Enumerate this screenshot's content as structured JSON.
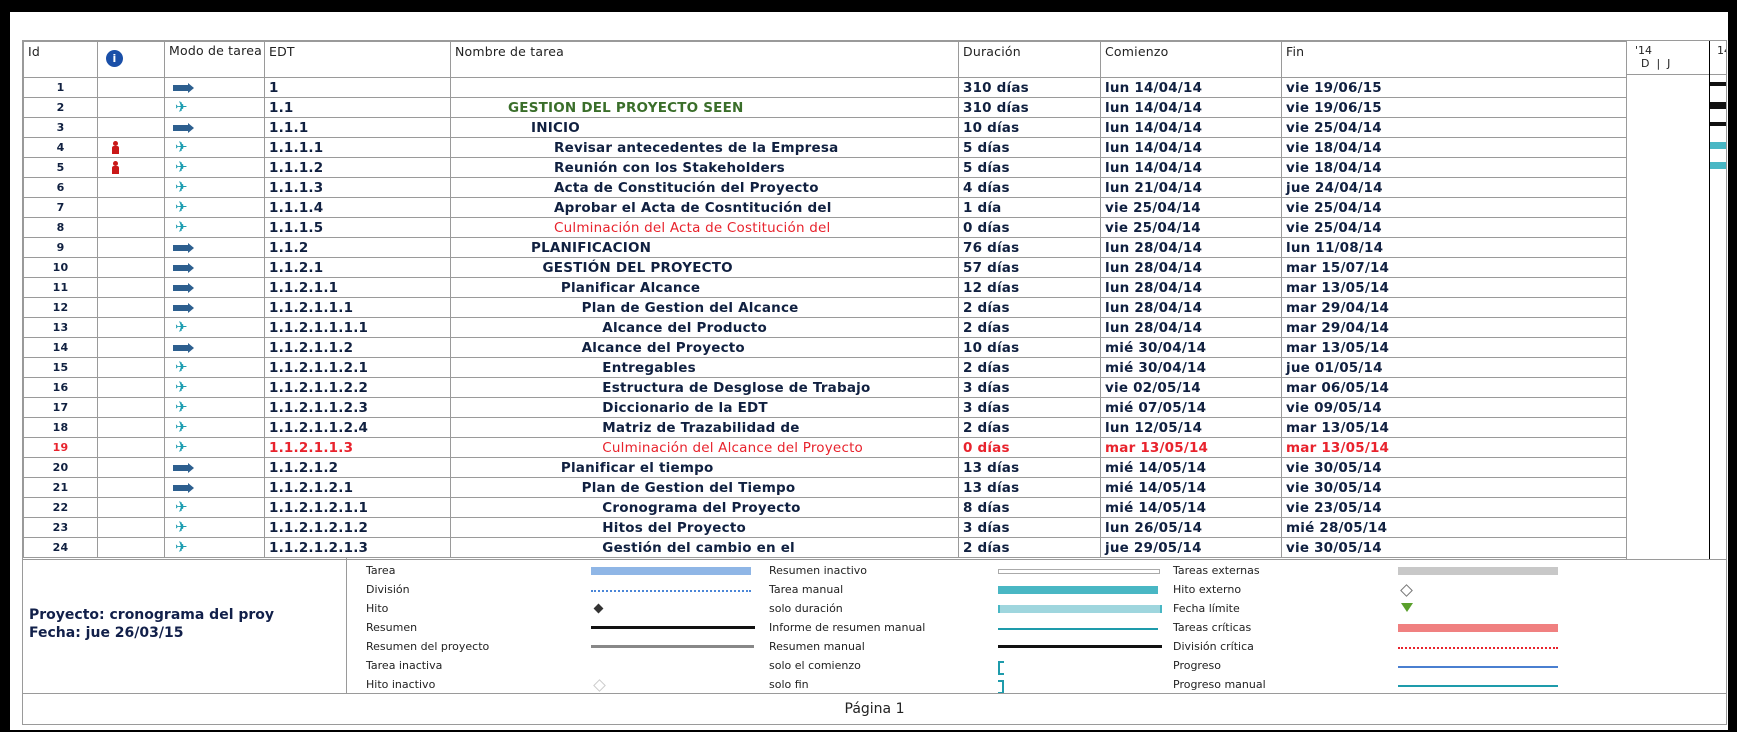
{
  "columns": {
    "id": "Id",
    "mode": "Modo de tarea",
    "edt": "EDT",
    "name": "Nombre de tarea",
    "duration": "Duración",
    "start": "Comienzo",
    "finish": "Fin"
  },
  "gantt_header": {
    "year": "'14",
    "year2": "14",
    "months": "D  |  J"
  },
  "rows": [
    {
      "id": "1",
      "mode": "auto",
      "resource": false,
      "edt": "1",
      "name": "",
      "indent": 0,
      "duration": "310 días",
      "start": "lun 14/04/14",
      "finish": "vie 19/06/15",
      "critical": false
    },
    {
      "id": "2",
      "mode": "manual",
      "resource": false,
      "edt": "1.1",
      "name": "GESTION DEL PROYECTO  SEEN",
      "indent": 1,
      "duration": "310 días",
      "start": "lun 14/04/14",
      "finish": "vie 19/06/15",
      "critical": false,
      "green": true
    },
    {
      "id": "3",
      "mode": "auto",
      "resource": false,
      "edt": "1.1.1",
      "name": "INICIO",
      "indent": 2,
      "duration": "10 días",
      "start": "lun 14/04/14",
      "finish": "vie 25/04/14",
      "critical": false
    },
    {
      "id": "4",
      "mode": "manual",
      "resource": true,
      "edt": "1.1.1.1",
      "name": "Revisar antecedentes de la Empresa",
      "indent": 3,
      "duration": "5 días",
      "start": "lun 14/04/14",
      "finish": "vie 18/04/14",
      "critical": false
    },
    {
      "id": "5",
      "mode": "manual",
      "resource": true,
      "edt": "1.1.1.2",
      "name": "Reunión con los Stakeholders",
      "indent": 3,
      "duration": "5 días",
      "start": "lun 14/04/14",
      "finish": "vie 18/04/14",
      "critical": false
    },
    {
      "id": "6",
      "mode": "manual",
      "resource": false,
      "edt": "1.1.1.3",
      "name": "Acta de Constitución del Proyecto",
      "indent": 3,
      "duration": "4 días",
      "start": "lun 21/04/14",
      "finish": "jue 24/04/14",
      "critical": false
    },
    {
      "id": "7",
      "mode": "manual",
      "resource": false,
      "edt": "1.1.1.4",
      "name": "Aprobar el Acta de Cosntitución del",
      "indent": 3,
      "duration": "1 día",
      "start": "vie 25/04/14",
      "finish": "vie 25/04/14",
      "critical": false
    },
    {
      "id": "8",
      "mode": "manual",
      "resource": false,
      "edt": "1.1.1.5",
      "name": "Culminación del Acta de Costitución del",
      "indent": 3,
      "duration": "0 días",
      "start": "vie 25/04/14",
      "finish": "vie 25/04/14",
      "critical": false,
      "redname": true
    },
    {
      "id": "9",
      "mode": "auto",
      "resource": false,
      "edt": "1.1.2",
      "name": "PLANIFICACION",
      "indent": 2,
      "duration": "76 días",
      "start": "lun 28/04/14",
      "finish": "lun 11/08/14",
      "critical": false
    },
    {
      "id": "10",
      "mode": "auto",
      "resource": false,
      "edt": "1.1.2.1",
      "name": "GESTIÓN DEL PROYECTO",
      "indent": 2.5,
      "duration": "57 días",
      "start": "lun 28/04/14",
      "finish": "mar 15/07/14",
      "critical": false
    },
    {
      "id": "11",
      "mode": "auto",
      "resource": false,
      "edt": "1.1.2.1.1",
      "name": "Planificar Alcance",
      "indent": 3.3,
      "duration": "12 días",
      "start": "lun 28/04/14",
      "finish": "mar 13/05/14",
      "critical": false
    },
    {
      "id": "12",
      "mode": "auto",
      "resource": false,
      "edt": "1.1.2.1.1.1",
      "name": "Plan de Gestion del Alcance",
      "indent": 4.2,
      "duration": "2 días",
      "start": "lun 28/04/14",
      "finish": "mar 29/04/14",
      "critical": false
    },
    {
      "id": "13",
      "mode": "manual",
      "resource": false,
      "edt": "1.1.2.1.1.1.1",
      "name": "Alcance del Producto",
      "indent": 5.1,
      "duration": "2 días",
      "start": "lun 28/04/14",
      "finish": "mar 29/04/14",
      "critical": false
    },
    {
      "id": "14",
      "mode": "auto",
      "resource": false,
      "edt": "1.1.2.1.1.2",
      "name": "Alcance del Proyecto",
      "indent": 4.2,
      "duration": "10 días",
      "start": "mié 30/04/14",
      "finish": "mar 13/05/14",
      "critical": false
    },
    {
      "id": "15",
      "mode": "manual",
      "resource": false,
      "edt": "1.1.2.1.1.2.1",
      "name": "Entregables",
      "indent": 5.1,
      "duration": "2 días",
      "start": "mié 30/04/14",
      "finish": "jue 01/05/14",
      "critical": false
    },
    {
      "id": "16",
      "mode": "manual",
      "resource": false,
      "edt": "1.1.2.1.1.2.2",
      "name": "Estructura de Desglose de Trabajo",
      "indent": 5.1,
      "duration": "3 días",
      "start": "vie 02/05/14",
      "finish": "mar 06/05/14",
      "critical": false
    },
    {
      "id": "17",
      "mode": "manual",
      "resource": false,
      "edt": "1.1.2.1.1.2.3",
      "name": "Diccionario de la EDT",
      "indent": 5.1,
      "duration": "3 días",
      "start": "mié 07/05/14",
      "finish": "vie 09/05/14",
      "critical": false
    },
    {
      "id": "18",
      "mode": "manual",
      "resource": false,
      "edt": "1.1.2.1.1.2.4",
      "name": "Matriz de Trazabilidad de",
      "indent": 5.1,
      "duration": "2 días",
      "start": "lun 12/05/14",
      "finish": "mar 13/05/14",
      "critical": false
    },
    {
      "id": "19",
      "mode": "manual",
      "resource": false,
      "edt": "1.1.2.1.1.3",
      "name": "Culminación del Alcance del Proyecto",
      "indent": 5.1,
      "duration": "0 días",
      "start": "mar 13/05/14",
      "finish": "mar 13/05/14",
      "critical": true
    },
    {
      "id": "20",
      "mode": "auto",
      "resource": false,
      "edt": "1.1.2.1.2",
      "name": "Planificar el tiempo",
      "indent": 3.3,
      "duration": "13 días",
      "start": "mié 14/05/14",
      "finish": "vie 30/05/14",
      "critical": false
    },
    {
      "id": "21",
      "mode": "auto",
      "resource": false,
      "edt": "1.1.2.1.2.1",
      "name": "Plan de Gestion del Tiempo",
      "indent": 4.2,
      "duration": "13 días",
      "start": "mié 14/05/14",
      "finish": "vie 30/05/14",
      "critical": false
    },
    {
      "id": "22",
      "mode": "manual",
      "resource": false,
      "edt": "1.1.2.1.2.1.1",
      "name": "Cronograma del Proyecto",
      "indent": 5.1,
      "duration": "8 días",
      "start": "mié 14/05/14",
      "finish": "vie 23/05/14",
      "critical": false
    },
    {
      "id": "23",
      "mode": "manual",
      "resource": false,
      "edt": "1.1.2.1.2.1.2",
      "name": "Hitos del Proyecto",
      "indent": 5.1,
      "duration": "3 días",
      "start": "lun 26/05/14",
      "finish": "mié 28/05/14",
      "critical": false
    },
    {
      "id": "24",
      "mode": "manual",
      "resource": false,
      "edt": "1.1.2.1.2.1.3",
      "name": "Gestión del cambio en el",
      "indent": 5.1,
      "duration": "2 días",
      "start": "jue 29/05/14",
      "finish": "vie 30/05/14",
      "critical": false
    }
  ],
  "legend": {
    "project_line": "Proyecto: cronograma del proy",
    "date_line": "Fecha: jue 26/03/15",
    "col1": [
      "Tarea",
      "División",
      "Hito",
      "Resumen",
      "Resumen del proyecto",
      "Tarea inactiva",
      "Hito inactivo"
    ],
    "col2": [
      "Resumen inactivo",
      "Tarea manual",
      "solo duración",
      "Informe de resumen manual",
      "Resumen manual",
      "solo el comienzo",
      "solo fin"
    ],
    "col3": [
      "Tareas externas",
      "Hito externo",
      "Fecha límite",
      "Tareas críticas",
      "División crítica",
      "Progreso",
      "Progreso manual"
    ]
  },
  "footer": {
    "page_label": "Página 1"
  },
  "colors": {
    "critical": "#e8232d",
    "text": "#102040",
    "manual_bar": "#49b7c4",
    "task_bar": "#8fb6e6",
    "critical_bar": "#f08080",
    "progress": "#4a7fd0"
  }
}
